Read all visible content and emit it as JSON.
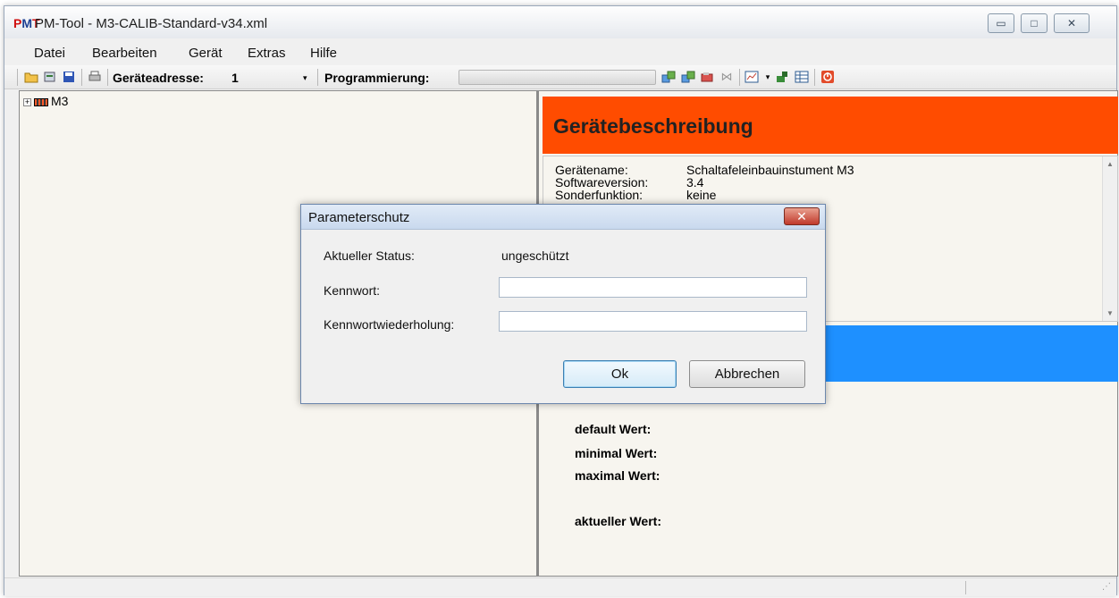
{
  "window": {
    "logo": "PMT",
    "title": "PM-Tool - M3-CALIB-Standard-v34.xml",
    "minimize": "▭",
    "maximize": "□",
    "close": "✕"
  },
  "menu": [
    "Datei",
    "Bearbeiten",
    "Gerät",
    "Extras",
    "Hilfe"
  ],
  "toolbar": {
    "address_label": "Geräteadresse:",
    "address_value": "1",
    "dropdown_arrow": "▾",
    "programming_label": "Programmierung:",
    "programming_progress": 0,
    "icons": [
      "open-icon",
      "device-icon",
      "save-icon",
      "print-icon",
      "read-device-icon",
      "write-device-icon",
      "transfer-icon",
      "connect-icon",
      "chart-icon",
      "dropdown-icon",
      "calibrate-icon",
      "table-icon",
      "power-icon"
    ]
  },
  "tree": {
    "expander": "+",
    "root": "M3"
  },
  "description": {
    "title": "Gerätebeschreibung",
    "rows": [
      {
        "label": "Gerätename:",
        "value": "Schaltafeleinbauinstument M3"
      },
      {
        "label": "Softwareversion:",
        "value": "3.4"
      },
      {
        "label": "Sonderfunktion:",
        "value": "keine"
      }
    ]
  },
  "parameters": {
    "default_label": "default Wert:",
    "min_label": "minimal Wert:",
    "max_label": "maximal Wert:",
    "current_label": "aktueller Wert:"
  },
  "dialog": {
    "title": "Parameterschutz",
    "close": "✕",
    "status_label": "Aktueller Status:",
    "status_value": "ungeschützt",
    "password_label": "Kennwort:",
    "password_value": "",
    "repeat_label": "Kennwortwiederholung:",
    "repeat_value": "",
    "ok": "Ok",
    "cancel": "Abbrechen"
  },
  "colors": {
    "header_orange": "#ff4c00",
    "band_blue": "#1e90ff"
  }
}
